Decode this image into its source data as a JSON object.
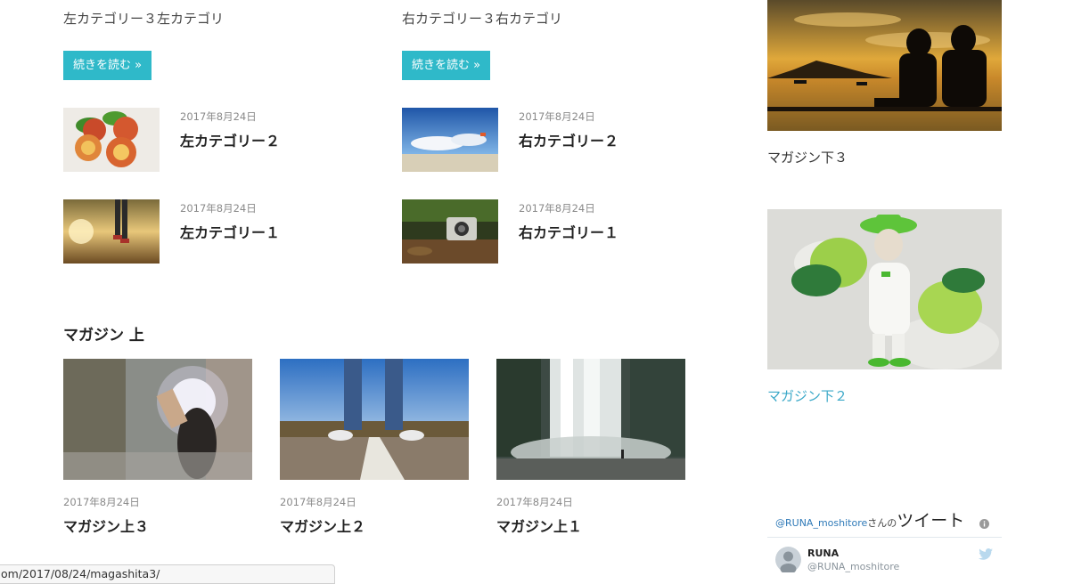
{
  "left_column": {
    "excerpt": "左カテゴリー３左カテゴリ",
    "read_more": "続きを読む »",
    "posts": [
      {
        "date": "2017年8月24日",
        "title": "左カテゴリー２"
      },
      {
        "date": "2017年8月24日",
        "title": "左カテゴリー１"
      }
    ]
  },
  "right_column": {
    "excerpt": "右カテゴリー３右カテゴリ",
    "read_more": "続きを読む »",
    "posts": [
      {
        "date": "2017年8月24日",
        "title": "右カテゴリー２"
      },
      {
        "date": "2017年8月24日",
        "title": "右カテゴリー１"
      }
    ]
  },
  "magazine_top": {
    "heading": "マガジン 上",
    "posts": [
      {
        "date": "2017年8月24日",
        "title": "マガジン上３"
      },
      {
        "date": "2017年8月24日",
        "title": "マガジン上２"
      },
      {
        "date": "2017年8月24日",
        "title": "マガジン上１"
      }
    ]
  },
  "sidebar": {
    "cards": [
      {
        "caption": "マガジン下３"
      },
      {
        "caption": "マガジン下２"
      }
    ],
    "twitter": {
      "handle_link": "@RUNA_moshitore",
      "san_no": "さんの",
      "tweet_word": "ツイート",
      "user_name": "RUNA",
      "user_handle": "@RUNA_moshitore"
    }
  },
  "status_bar": {
    "url": "om/2017/08/24/magashita3/"
  },
  "colors": {
    "accent": "#2fb9c9",
    "link": "#3aa8c8",
    "twitter_link": "#2f7ab8"
  },
  "icons": [
    "info-icon",
    "twitter-bird-icon",
    "avatar-icon"
  ]
}
